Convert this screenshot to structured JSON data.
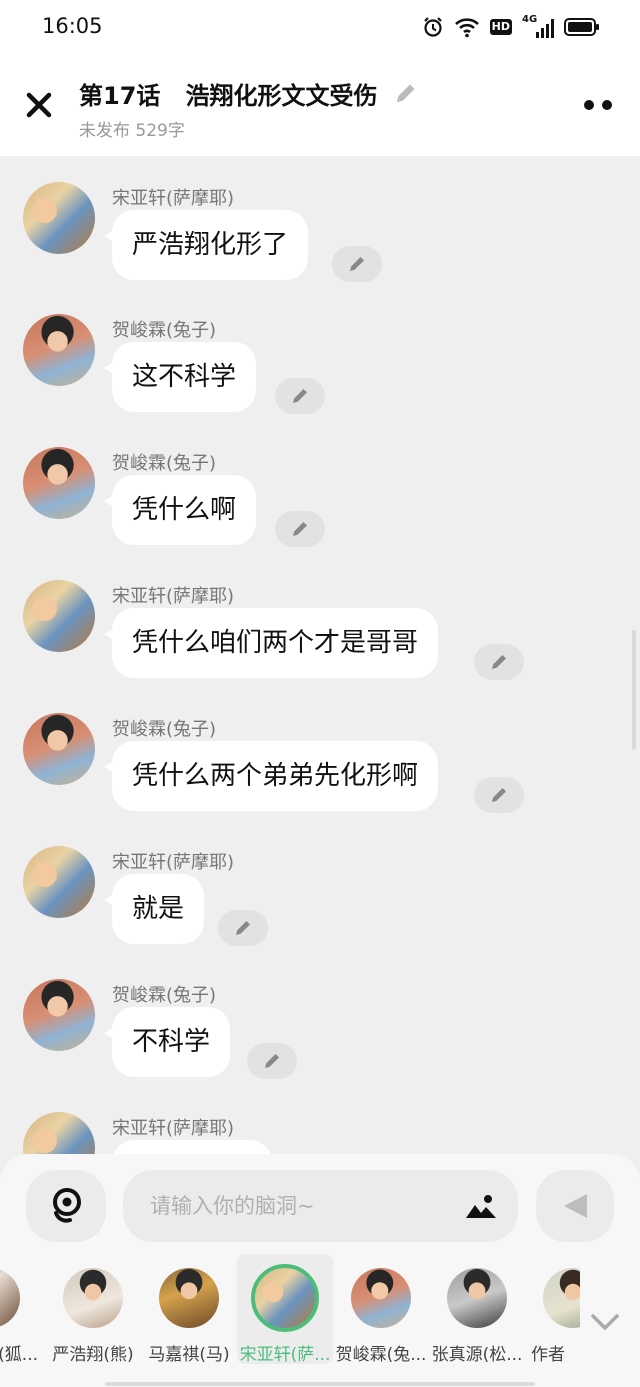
{
  "status": {
    "time": "16:05",
    "hd": "HD",
    "network": "4G"
  },
  "header": {
    "title": "第17话   浩翔化形文文受伤",
    "subtitle": "未发布 529字"
  },
  "messages": [
    {
      "sender": "宋亚轩(萨摩耶)",
      "text": "严浩翔化形了"
    },
    {
      "sender": "贺峻霖(兔子)",
      "text": "这不科学"
    },
    {
      "sender": "贺峻霖(兔子)",
      "text": "凭什么啊"
    },
    {
      "sender": "宋亚轩(萨摩耶)",
      "text": "凭什么咱们两个才是哥哥"
    },
    {
      "sender": "贺峻霖(兔子)",
      "text": "凭什么两个弟弟先化形啊"
    },
    {
      "sender": "宋亚轩(萨摩耶)",
      "text": "就是"
    },
    {
      "sender": "贺峻霖(兔子)",
      "text": "不科学"
    },
    {
      "sender": "宋亚轩(萨摩耶)",
      "text": ""
    }
  ],
  "composer": {
    "placeholder": "请输入你的脑洞~"
  },
  "characters": [
    {
      "name": "(狐..."
    },
    {
      "name": "严浩翔(熊)"
    },
    {
      "name": "马嘉祺(马)"
    },
    {
      "name": "宋亚轩(萨...",
      "selected": true
    },
    {
      "name": "贺峻霖(兔..."
    },
    {
      "name": "张真源(松..."
    },
    {
      "name": "作者"
    }
  ],
  "colors": {
    "accent": "#4dbe7a",
    "background": "#efefef",
    "bubble": "#ffffff"
  }
}
